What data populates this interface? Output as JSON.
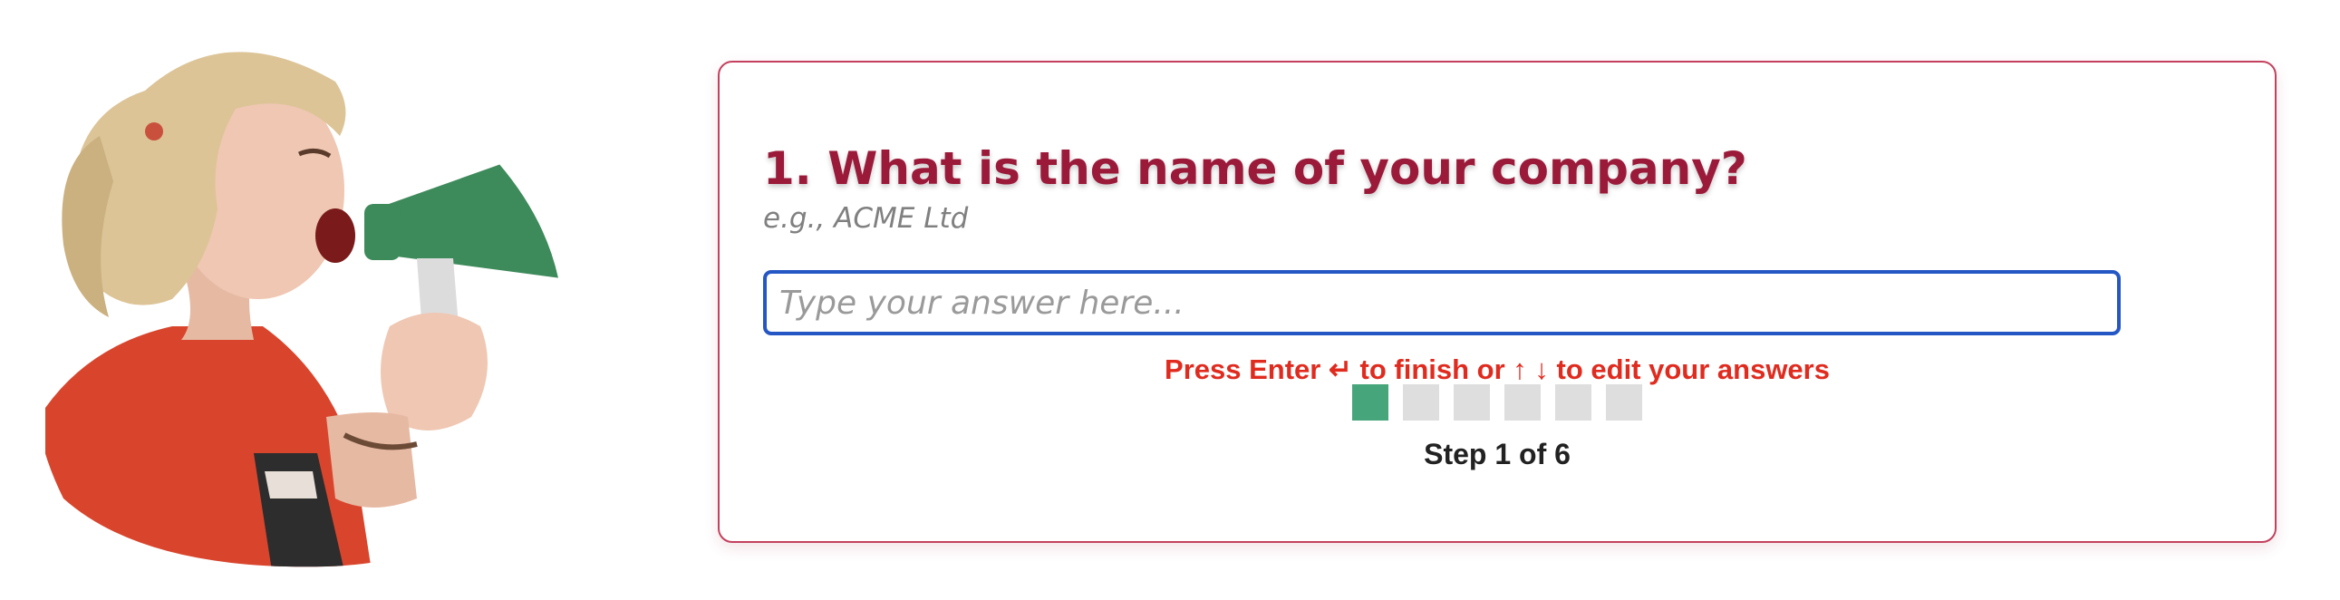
{
  "question": {
    "number": "1.",
    "title": "1. What is the name of your company?",
    "hint": "e.g., ACME Ltd",
    "placeholder": "Type your answer here...",
    "value": ""
  },
  "instructions": "Press Enter ↵ to finish or ↑ ↓ to edit your answers",
  "progress": {
    "current": 1,
    "total": 6,
    "label": "Step 1 of 6",
    "steps": [
      {
        "state": "done"
      },
      {
        "state": "pending"
      },
      {
        "state": "pending"
      },
      {
        "state": "pending"
      },
      {
        "state": "pending"
      },
      {
        "state": "pending"
      }
    ]
  },
  "illustration": {
    "subject": "woman-shouting-into-megaphone"
  },
  "colors": {
    "title": "#9b1a3a",
    "card_border": "#c4415e",
    "input_border": "#2557c4",
    "instructions": "#e02b1f",
    "step_done": "#46a57a",
    "step_pending": "#dedede"
  }
}
